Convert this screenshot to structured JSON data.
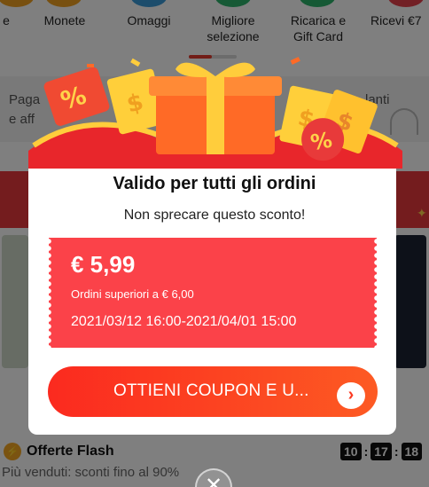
{
  "categories": [
    {
      "label": "e",
      "color": "#f0a020"
    },
    {
      "label": "Monete",
      "color": "#f0a020"
    },
    {
      "label": "Omaggi",
      "color": "#3a9bd9"
    },
    {
      "label": "Migliore\nselezione",
      "color": "#2db36b"
    },
    {
      "label": "Ricarica e\nGift Card",
      "color": "#2db36b"
    },
    {
      "label": "Ricevi €7",
      "color": "#e5414a"
    }
  ],
  "info_card": {
    "line1": "Paga",
    "line2": "e aff",
    "right_text": "lanti"
  },
  "flash": {
    "title": "Offerte Flash",
    "subtitle": "Più venduti: sconti fino al 90%",
    "timer": [
      "10",
      "17",
      "18"
    ]
  },
  "modal": {
    "title": "Valido per tutti gli ordini",
    "subtitle": "Non sprecare questo sconto!",
    "coupon": {
      "amount": "€ 5,99",
      "min_order": "Ordini superiori a € 6,00",
      "validity": "2021/03/12 16:00-2021/04/01 15:00"
    },
    "cta_label": "OTTIENI COUPON E U...",
    "cta_icon": "chevron-right-icon",
    "close_icon": "close-icon"
  },
  "colors": {
    "accent": "#fb4249",
    "cta": "#fb2a1f",
    "overlay": "rgba(0,0,0,0.5)"
  }
}
